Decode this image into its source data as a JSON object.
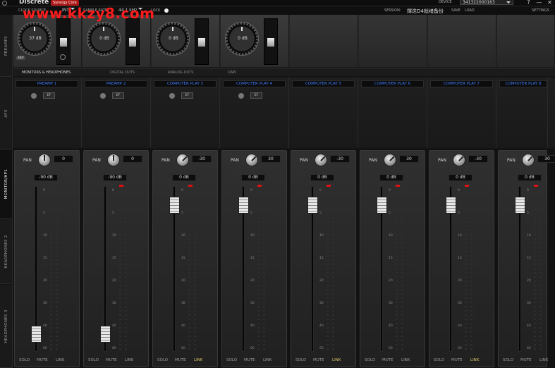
{
  "app": {
    "title": "Discrete 4",
    "badge": "Synergy Core",
    "device_label": "DEVICE",
    "device_value": "341322000163",
    "window_buttons": [
      "?",
      "—",
      "✕"
    ]
  },
  "toolbar": {
    "clock_source": "CLOCK SOURCE",
    "clock_value": "INT",
    "sample_rate": "SAMPLE RATE",
    "sample_value": "44.1 kHz",
    "lock": "LOCK",
    "session": "SESSION:",
    "session_value": "揮迭D4就绪备份",
    "save": "SAVE",
    "load": "LOAD",
    "settings": "SETTINGS"
  },
  "watermark": "www.kkzy8.com",
  "side_tabs": [
    "PREAMPS",
    "AFX",
    "MONITOR/HP1",
    "HEADPHONES 2",
    "HEADPHONES 3"
  ],
  "preamps": [
    {
      "value": "37 dB",
      "phantom": "48V"
    },
    {
      "value": "0 dB"
    },
    {
      "value": "0 dB"
    },
    {
      "value": "0 dB"
    }
  ],
  "section_tabs": [
    "MONITORS & HEADPHONES",
    "DIGITAL OUTS",
    "ANALOG OUTS",
    "DAW"
  ],
  "afx_button_label": "EF",
  "channels": [
    {
      "label": "PREAMP 1",
      "pan_label": "PAN",
      "pan": "0",
      "gain": "-90 dB",
      "fader_level": 0.06,
      "has_afx": true,
      "peak": false,
      "link_on": false
    },
    {
      "label": "PREAMP 2",
      "pan_label": "PAN",
      "pan": "0",
      "gain": "-90 dB",
      "fader_level": 0.06,
      "has_afx": true,
      "peak": true,
      "link_on": false
    },
    {
      "label": "COMPUTER PLAY 3",
      "pan_label": "PAN",
      "pan": "-30",
      "gain": "0 dB",
      "fader_level": 0.93,
      "has_afx": true,
      "peak": true,
      "link_on": true
    },
    {
      "label": "COMPUTER PLAY 4",
      "pan_label": "PAN",
      "pan": "30",
      "gain": "0 dB",
      "fader_level": 0.93,
      "has_afx": true,
      "peak": true,
      "link_on": false
    },
    {
      "label": "COMPUTER PLAY 5",
      "pan_label": "PAN",
      "pan": "-30",
      "gain": "0 dB",
      "fader_level": 0.93,
      "has_afx": false,
      "peak": true,
      "link_on": true
    },
    {
      "label": "COMPUTER PLAY 6",
      "pan_label": "PAN",
      "pan": "30",
      "gain": "0 dB",
      "fader_level": 0.93,
      "has_afx": false,
      "peak": true,
      "link_on": false
    },
    {
      "label": "COMPUTER PLAY 7",
      "pan_label": "PAN",
      "pan": "-30",
      "gain": "0 dB",
      "fader_level": 0.93,
      "has_afx": false,
      "peak": true,
      "link_on": true
    },
    {
      "label": "COMPUTER PLAY 8",
      "pan_label": "PAN",
      "pan": "30",
      "gain": "0 dB",
      "fader_level": 0.93,
      "has_afx": false,
      "peak": true,
      "link_on": false
    }
  ],
  "scale_ticks": [
    "0",
    "5",
    "10",
    "15",
    "20",
    "30",
    "40",
    "60"
  ],
  "strip_buttons": [
    "SOLO",
    "MUTE",
    "LINK"
  ],
  "colors": {
    "accent_blue": "#3d7bff",
    "peak_red": "#d11111",
    "link_on": "#d9c36a"
  }
}
